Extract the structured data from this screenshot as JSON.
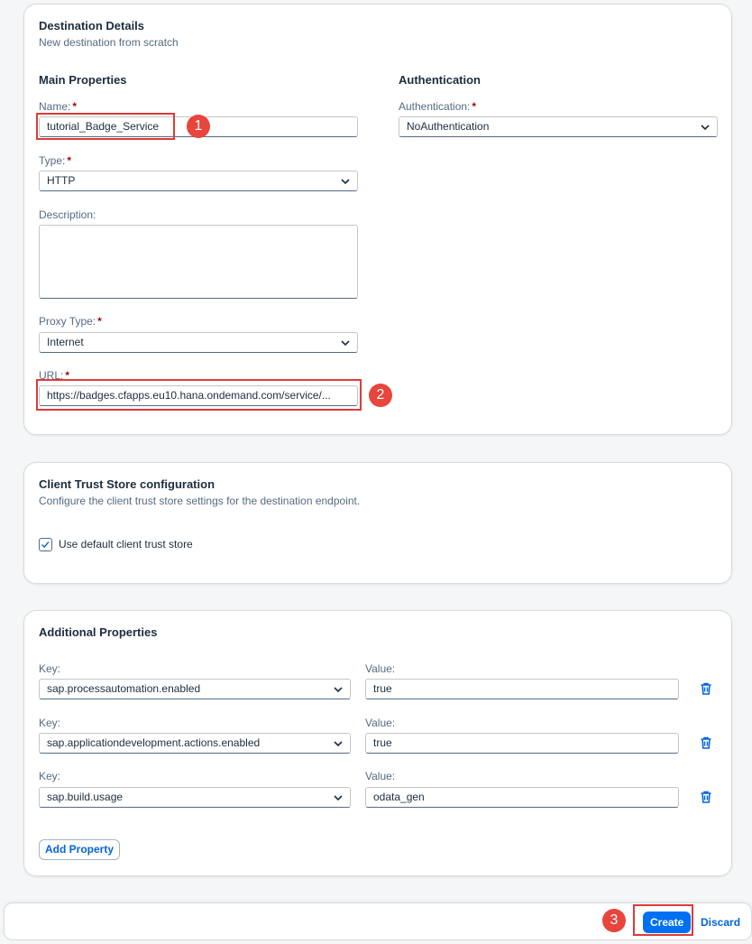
{
  "destination": {
    "title": "Destination Details",
    "subtitle": "New destination from scratch",
    "main_properties": {
      "title": "Main Properties",
      "name_label": "Name:",
      "name_value": "tutorial_Badge_Service",
      "type_label": "Type:",
      "type_value": "HTTP",
      "description_label": "Description:",
      "description_value": "",
      "proxy_label": "Proxy Type:",
      "proxy_value": "Internet",
      "url_label": "URL:",
      "url_value": "https://badges.cfapps.eu10.hana.ondemand.com/service/..."
    },
    "authentication": {
      "title": "Authentication",
      "label": "Authentication:",
      "value": "NoAuthentication"
    },
    "required_marker": "*"
  },
  "trust_store": {
    "title": "Client Trust Store configuration",
    "subtitle": "Configure the client trust store settings for the destination endpoint.",
    "checkbox_label": "Use default client trust store",
    "checked": true
  },
  "additional": {
    "title": "Additional Properties",
    "key_label": "Key:",
    "value_label": "Value:",
    "rows": [
      {
        "key": "sap.processautomation.enabled",
        "value": "true"
      },
      {
        "key": "sap.applicationdevelopment.actions.enabled",
        "value": "true"
      },
      {
        "key": "sap.build.usage",
        "value": "odata_gen"
      }
    ],
    "add_label": "Add Property"
  },
  "footer": {
    "create_label": "Create",
    "discard_label": "Discard"
  },
  "annotations": {
    "step1": "1",
    "step2": "2",
    "step3": "3",
    "color": "#e03a3a"
  },
  "icons": {
    "select": "chevron-down-icon",
    "delete": "trash-icon",
    "check": "checkmark-icon"
  }
}
